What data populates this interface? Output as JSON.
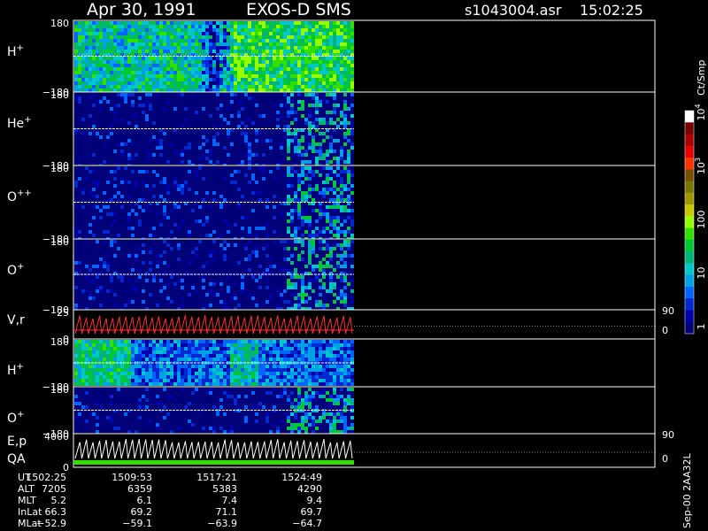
{
  "header": {
    "date": "Apr 30, 1991",
    "instrument": "EXOS-D SMS",
    "file": "s1043004.asr",
    "time": "15:02:25"
  },
  "colorbar": {
    "unit": "Ct/Smp",
    "ticks": [
      {
        "label": "1",
        "value": 1
      },
      {
        "label": "10",
        "value": 10
      },
      {
        "label": "100",
        "value": 100
      },
      {
        "label": "10",
        "sup": "3",
        "value": 1000
      },
      {
        "label": "10",
        "sup": "4",
        "value": 10000
      }
    ],
    "colors": [
      "#000078",
      "#0000a8",
      "#0028d0",
      "#0064ff",
      "#00a0e6",
      "#00c8c8",
      "#00b478",
      "#00c832",
      "#32e000",
      "#96ff00",
      "#c8c800",
      "#a09600",
      "#787800",
      "#785000",
      "#ff3200",
      "#e60000",
      "#aa0000",
      "#780000",
      "#ffffff"
    ]
  },
  "chart_data": {
    "type": "heatmap",
    "panels": [
      {
        "label": "H",
        "sup": "+",
        "ytop": "180",
        "ybot": "−180",
        "intensity": "high"
      },
      {
        "label": "He",
        "sup": "+",
        "ytop": "180",
        "ybot": "−180",
        "intensity": "low"
      },
      {
        "label": "O",
        "sup": "++",
        "ytop": "180",
        "ybot": "−180",
        "intensity": "low"
      },
      {
        "label": "O",
        "sup": "+",
        "ytop": "180",
        "ybot": "−180",
        "intensity": "low"
      },
      {
        "label": "V,r",
        "sup": "",
        "ytop": "25",
        "ybot": "0",
        "right_top": "90",
        "right_bot": "0",
        "kind": "line"
      },
      {
        "label": "H",
        "sup": "+",
        "ytop": "180",
        "ybot": "−180",
        "intensity": "mid"
      },
      {
        "label": "O",
        "sup": "+",
        "ytop": "180",
        "ybot": "−180",
        "intensity": "low2"
      },
      {
        "label": "E,p",
        "label2": "QA",
        "sup": "",
        "ytop": "4000",
        "ybot": "0",
        "right_top": "90",
        "right_bot": "0",
        "kind": "line2"
      }
    ],
    "orbit": {
      "rows": [
        "UT",
        "ALT",
        "MLT",
        "InLat",
        "MLat"
      ],
      "columns": [
        [
          "1502:25",
          "7205",
          "5.2",
          "66.3",
          "−52.9"
        ],
        [
          "1509:53",
          "6359",
          "6.1",
          "69.2",
          "−59.1"
        ],
        [
          "1517:21",
          "5383",
          "7.4",
          "71.1",
          "−63.9"
        ],
        [
          "1524:49",
          "4290",
          "9.4",
          "69.7",
          "−64.7"
        ]
      ]
    }
  },
  "footer": {
    "side_label": "Sep-00 2AA32L"
  }
}
